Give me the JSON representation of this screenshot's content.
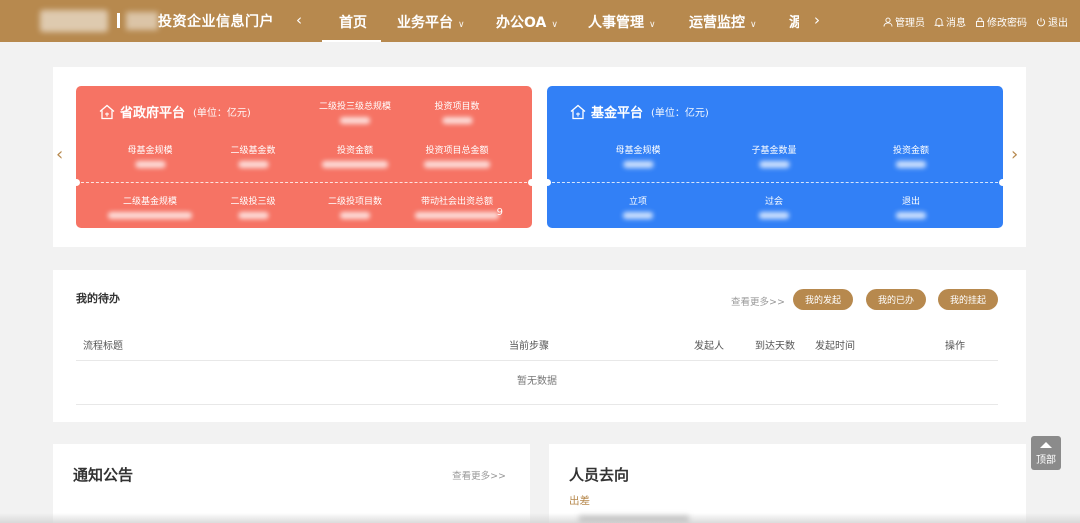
{
  "header": {
    "portal_title": "投资企业信息门户",
    "nav": [
      {
        "label": "首页",
        "active": true
      },
      {
        "label": "业务平台"
      },
      {
        "label": "办公OA"
      },
      {
        "label": "人事管理"
      },
      {
        "label": "运营监控"
      }
    ],
    "nav_partial": "源",
    "user_links": {
      "admin": "管理员",
      "messages": "消息",
      "change_password": "修改密码",
      "logout": "退出"
    },
    "colors": {
      "bar": "#b7894e"
    }
  },
  "stats": {
    "gov": {
      "name": "省政府平台",
      "unit": "(单位：亿元)",
      "row0": [
        "二级投三级总规模",
        "投资项目数"
      ],
      "row1": [
        "母基金规模",
        "二级基金数",
        "投资金额",
        "投资项目总金额"
      ],
      "row2": [
        "二级基金规模",
        "二级投三级",
        "二级投项目数",
        "带动社会出资总额"
      ],
      "partial_suffix": "9",
      "color": "#f67364"
    },
    "fund": {
      "name": "基金平台",
      "unit": "(单位：亿元)",
      "row1": [
        "母基金规模",
        "子基金数量",
        "投资金额"
      ],
      "row2": [
        "立项",
        "过会",
        "退出"
      ],
      "color": "#3280f6"
    }
  },
  "todo": {
    "title": "我的待办",
    "more": "查看更多>>",
    "buttons": [
      "我的发起",
      "我的已办",
      "我的挂起"
    ],
    "columns": [
      "流程标题",
      "当前步骤",
      "发起人",
      "到达天数",
      "发起时间",
      "操作"
    ],
    "empty": "暂无数据"
  },
  "notice": {
    "title": "通知公告",
    "more": "查看更多>>"
  },
  "people": {
    "title": "人员去向",
    "subtitle": "出差"
  },
  "back_top": "顶部"
}
